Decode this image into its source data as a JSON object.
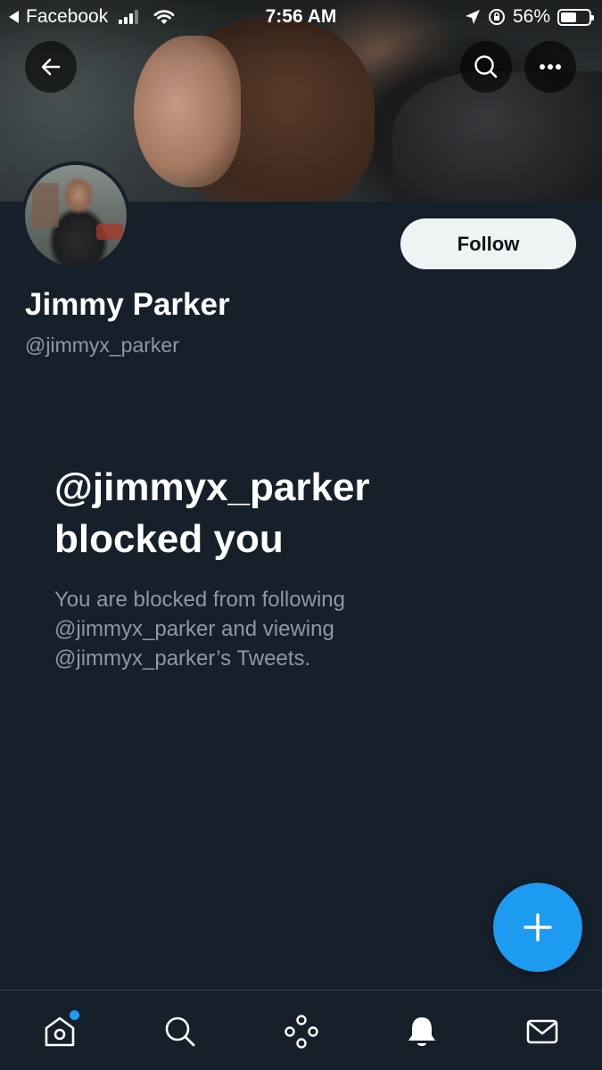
{
  "status_bar": {
    "back_app": "Facebook",
    "time": "7:56 AM",
    "battery": "56%",
    "battery_level": 0.56
  },
  "header": {
    "back_icon": "arrow-left-icon",
    "search_icon": "search-icon",
    "more_icon": "more-horizontal-icon"
  },
  "profile": {
    "display_name": "Jimmy Parker",
    "handle": "@jimmyx_parker",
    "follow_label": "Follow"
  },
  "blocked": {
    "title_line1": "@jimmyx_parker",
    "title_line2": "blocked you",
    "line1": "You are blocked from following",
    "line2": "@jimmyx_parker and viewing",
    "line3": "@jimmyx_parker’s Tweets."
  },
  "fab": {
    "icon": "plus-icon"
  },
  "bottom_nav": [
    {
      "name": "home",
      "icon": "home-icon",
      "has_dot": true
    },
    {
      "name": "search",
      "icon": "search-icon"
    },
    {
      "name": "spaces",
      "icon": "spaces-icon"
    },
    {
      "name": "notifications",
      "icon": "bell-icon"
    },
    {
      "name": "messages",
      "icon": "mail-icon"
    }
  ],
  "colors": {
    "background": "#15202b",
    "accent": "#1d9bf0",
    "secondary_text": "#8b98a5",
    "follow_bg": "#eff3f4"
  }
}
